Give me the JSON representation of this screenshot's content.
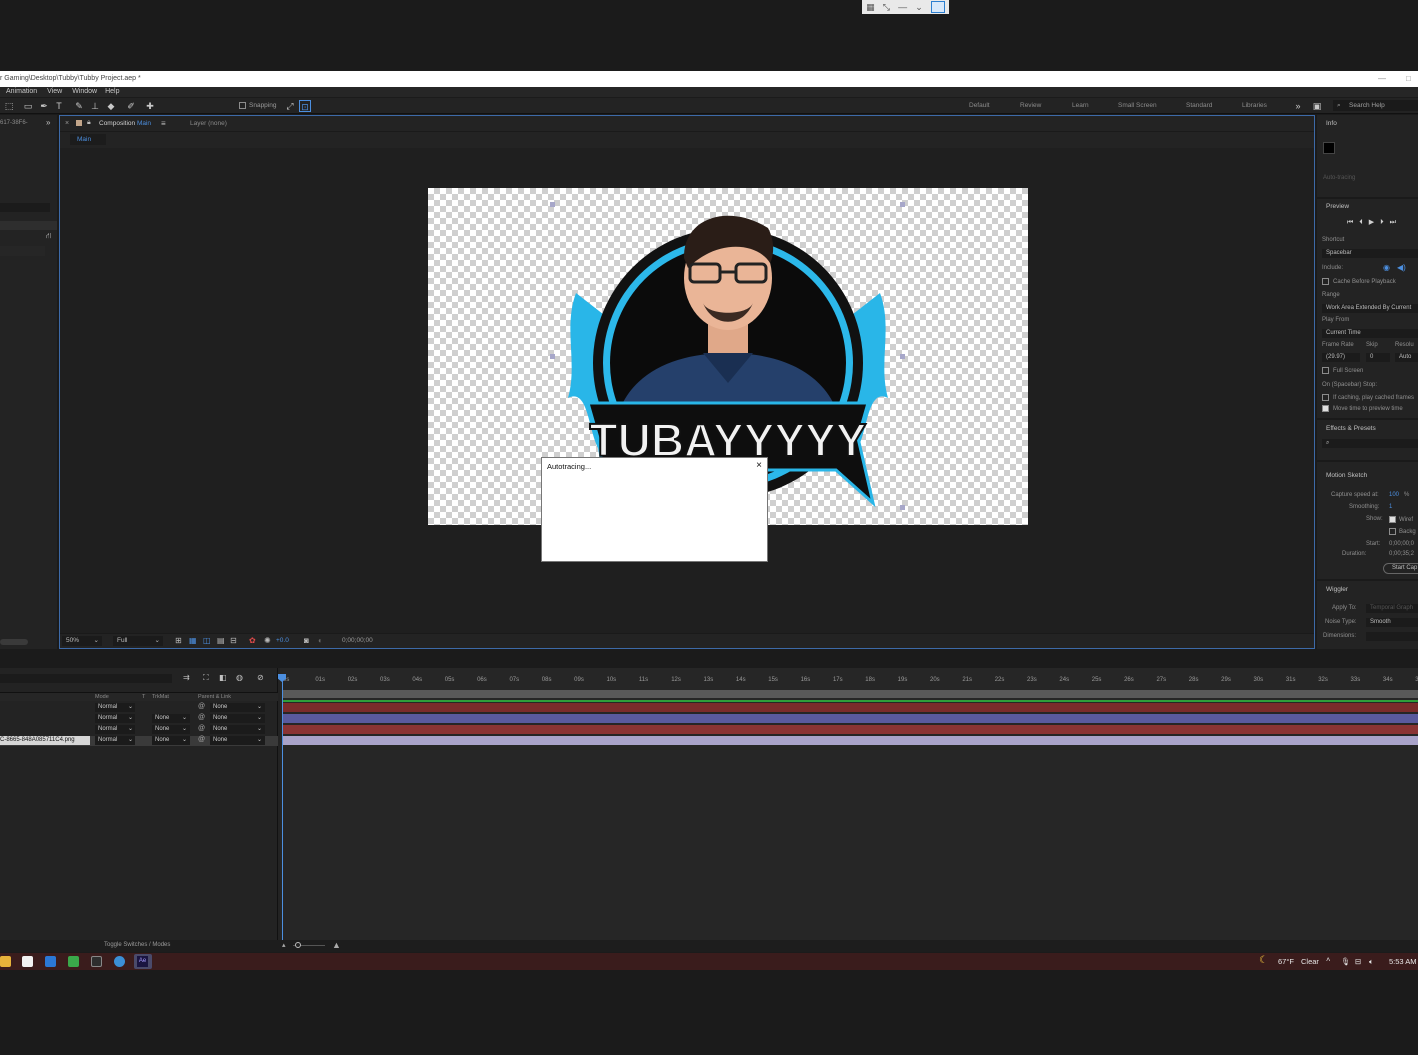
{
  "window": {
    "title": "r Gaming\\Desktop\\Tubby\\Tubby Project.aep *"
  },
  "remote_bar": {
    "icons": [
      "grid-icon",
      "collapse-icon",
      "minimize-icon",
      "chevron-down-icon",
      "monitor-icon"
    ]
  },
  "menu": [
    "Animation",
    "View",
    "Window",
    "Help"
  ],
  "toolbar": {
    "snapping_label": "Snapping",
    "workspaces": [
      "Default",
      "Review",
      "Learn",
      "Small Screen",
      "Standard",
      "Libraries"
    ],
    "search_placeholder": "Search Help"
  },
  "left_panel": {
    "label": "617-38F6-"
  },
  "composition": {
    "tab_label": "Composition",
    "tab_name": "Main",
    "layer_label": "Layer (none)",
    "breadcrumb": "Main",
    "logo_text": "TUBAYYYYY",
    "footer": {
      "zoom": "50%",
      "resolution": "Full",
      "exposure": "+0.0",
      "timecode": "0;00;00;00"
    }
  },
  "dialog": {
    "title": "Autotracing..."
  },
  "right_panel": {
    "info": {
      "title": "Info",
      "section": "Auto-tracing"
    },
    "preview": {
      "title": "Preview",
      "shortcut_label": "Shortcut",
      "shortcut_value": "Spacebar",
      "include_label": "Include:",
      "cache_label": "Cache Before Playback",
      "range_label": "Range",
      "range_value": "Work Area Extended By Current",
      "play_from_label": "Play From",
      "play_from_value": "Current Time",
      "frame_rate_label": "Frame Rate",
      "skip_label": "Skip",
      "resolution_label": "Resolu",
      "frame_rate_value": "(29.97)",
      "skip_value": "0",
      "resolution_value": "Auto",
      "full_screen_label": "Full Screen",
      "on_stop_label": "On (Spacebar) Stop:",
      "if_caching_label": "If caching, play cached frames",
      "move_time_label": "Move time to preview time"
    },
    "effects": {
      "title": "Effects & Presets"
    },
    "motion_sketch": {
      "title": "Motion Sketch",
      "capture_label": "Capture speed at:",
      "capture_value": "100",
      "capture_unit": "%",
      "smoothing_label": "Smoothing:",
      "smoothing_value": "1",
      "show_label": "Show:",
      "wireframe_label": "Wiref",
      "background_label": "Backg",
      "start_label": "Start:",
      "start_value": "0;00;00;0",
      "duration_label": "Duration:",
      "duration_value": "0;00;35;2",
      "button_label": "Start Cap"
    },
    "wiggler": {
      "title": "Wiggler",
      "apply_label": "Apply To:",
      "apply_value": "Temporal Graph",
      "noise_label": "Noise Type:",
      "noise_value": "Smooth",
      "dimensions_label": "Dimensions:"
    }
  },
  "timeline": {
    "headers": {
      "mode": "Mode",
      "t": "T",
      "trkmat": "TrkMat",
      "parent": "Parent & Link"
    },
    "layers": [
      {
        "name": "",
        "mode": "Normal",
        "trkmat": "",
        "parent": "None",
        "color": "#7a2b2b"
      },
      {
        "name": "",
        "mode": "Normal",
        "trkmat": "None",
        "parent": "None",
        "color": "#5a5a9e"
      },
      {
        "name": "",
        "mode": "Normal",
        "trkmat": "None",
        "parent": "None",
        "color": "#8a3434"
      },
      {
        "name": "C-8665-848A085711C4.png",
        "mode": "Normal",
        "trkmat": "None",
        "parent": "None",
        "color": "#a9a3c9"
      }
    ],
    "ticks": [
      "0s",
      "01s",
      "02s",
      "03s",
      "04s",
      "05s",
      "06s",
      "07s",
      "08s",
      "09s",
      "10s",
      "11s",
      "12s",
      "13s",
      "14s",
      "15s",
      "16s",
      "17s",
      "18s",
      "19s",
      "20s",
      "21s",
      "22s",
      "23s",
      "24s",
      "25s",
      "26s",
      "27s",
      "28s",
      "29s",
      "30s",
      "31s",
      "32s",
      "33s",
      "34s",
      "35s"
    ],
    "toggle_label": "Toggle Switches / Modes"
  },
  "taskbar": {
    "weather_temp": "67°F",
    "weather_text": "Clear",
    "time": "5:53 AM",
    "apps": [
      "file-explorer-icon",
      "notes-icon",
      "mail-icon",
      "spreadsheet-icon",
      "terminal-icon",
      "chat-icon",
      "after-effects-icon"
    ]
  }
}
